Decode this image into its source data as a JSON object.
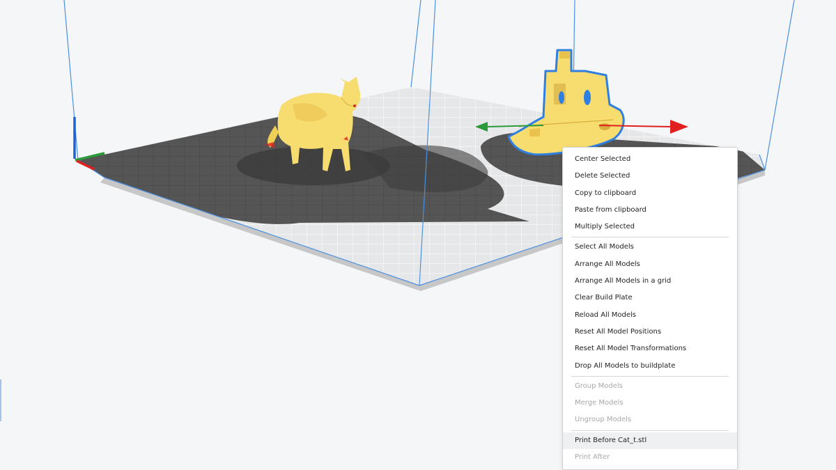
{
  "context_menu": {
    "groups": [
      [
        {
          "label": "Center Selected",
          "enabled": true
        },
        {
          "label": "Delete Selected",
          "enabled": true
        },
        {
          "label": "Copy to clipboard",
          "enabled": true
        },
        {
          "label": "Paste from clipboard",
          "enabled": true
        },
        {
          "label": "Multiply Selected",
          "enabled": true
        }
      ],
      [
        {
          "label": "Select All Models",
          "enabled": true
        },
        {
          "label": "Arrange All Models",
          "enabled": true
        },
        {
          "label": "Arrange All Models in a grid",
          "enabled": true
        },
        {
          "label": "Clear Build Plate",
          "enabled": true
        },
        {
          "label": "Reload All Models",
          "enabled": true
        },
        {
          "label": "Reset All Model Positions",
          "enabled": true
        },
        {
          "label": "Reset All Model Transformations",
          "enabled": true
        },
        {
          "label": "Drop All Models to buildplate",
          "enabled": true
        }
      ],
      [
        {
          "label": "Group Models",
          "enabled": false
        },
        {
          "label": "Merge Models",
          "enabled": false
        },
        {
          "label": "Ungroup Models",
          "enabled": false
        }
      ],
      [
        {
          "label": "Print Before Cat_t.stl",
          "enabled": true,
          "highlighted": true
        },
        {
          "label": "Print After",
          "enabled": false
        }
      ]
    ]
  },
  "scene": {
    "models": [
      {
        "name": "cat",
        "selected": false
      },
      {
        "name": "boat",
        "selected": true
      }
    ],
    "colors": {
      "background": "#f5f6f7",
      "model": "#f7dc6f",
      "model_shade": "#e9c24e",
      "selection_outline": "#2f7fe0",
      "build_plate_light": "#e4e5e7",
      "build_plate_shadow": "#4d4d4d",
      "volume_edge": "#4a90e2",
      "axis_x": "#e02020",
      "axis_y": "#2a9a3a",
      "axis_z": "#2060d0"
    }
  }
}
